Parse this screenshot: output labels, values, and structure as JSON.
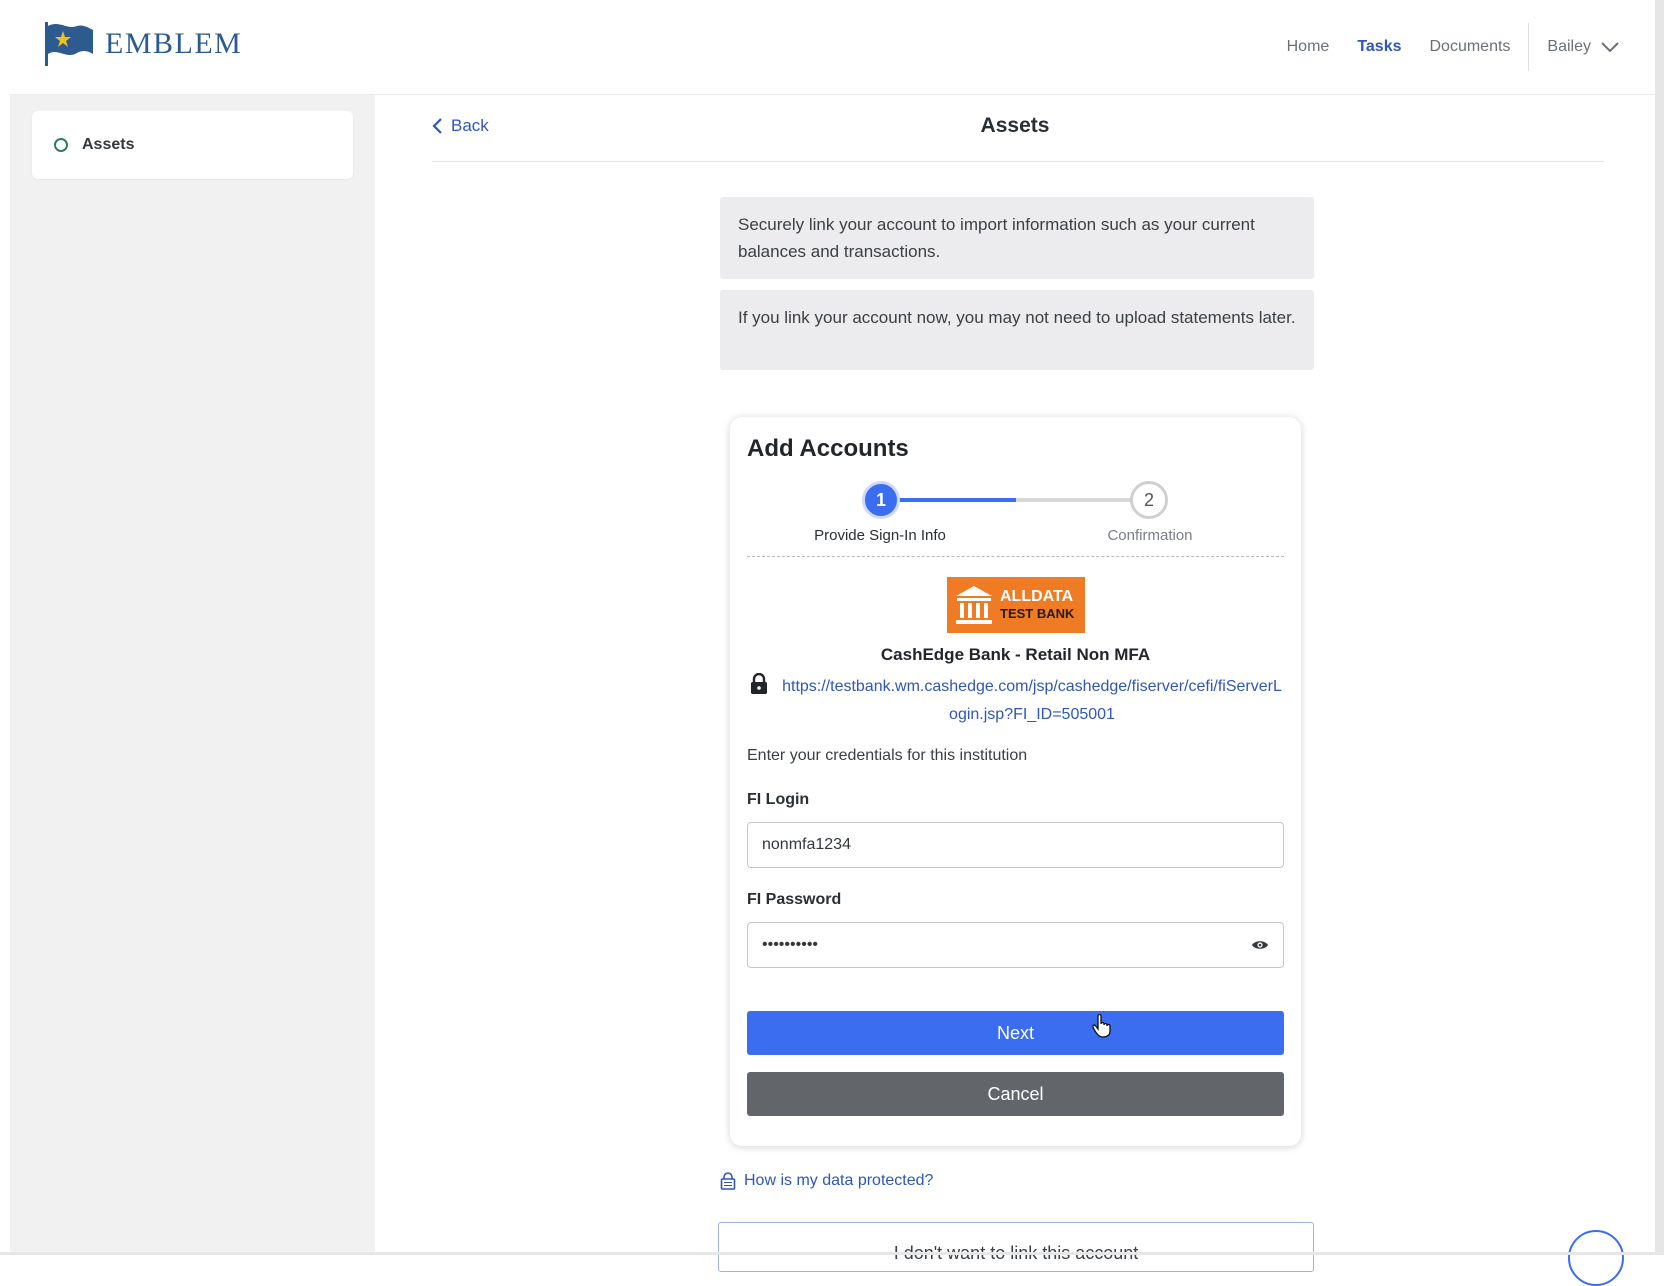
{
  "header": {
    "brand": "EMBLEM",
    "nav": [
      {
        "label": "Home"
      },
      {
        "label": "Tasks"
      },
      {
        "label": "Documents"
      }
    ],
    "user": "Bailey"
  },
  "sidebar": {
    "items": [
      {
        "label": "Assets"
      }
    ]
  },
  "main": {
    "back_label": "Back",
    "title": "Assets",
    "info1": "Securely link your account to import information such as your current balances and transactions.",
    "info2": "If you link your account now, you may not need to upload statements later."
  },
  "card": {
    "title": "Add Accounts",
    "steps": [
      {
        "number": "1",
        "label": "Provide Sign-In Info"
      },
      {
        "number": "2",
        "label": "Confirmation"
      }
    ],
    "bank_logo_line1": "ALLDATA",
    "bank_logo_line2": "TEST BANK",
    "bank_name": "CashEdge Bank - Retail Non MFA",
    "bank_url": "https://testbank.wm.cashedge.com/jsp/cashedge/fiserver/cefi/fiServerLogin.jsp?FI_ID=505001",
    "cred_note": "Enter your credentials for this institution",
    "login_label": "FI Login",
    "login_value": "nonmfa1234",
    "password_label": "FI Password",
    "password_value": "••••••••••",
    "next_label": "Next",
    "cancel_label": "Cancel"
  },
  "footer": {
    "protect_link": "How is my data protected?",
    "skip_label": "I don't want to link this account"
  },
  "colors": {
    "accent": "#3b6df0",
    "nav_active": "#2f57b8",
    "bank_orange": "#ef7b24",
    "cancel": "#62666b"
  },
  "icons": {
    "logo": "flag-icon",
    "back": "chevron-left-icon",
    "user_menu": "chevron-down-icon",
    "password_toggle": "eye-icon",
    "secure": "lock-icon",
    "bank": "bank-building-icon"
  }
}
